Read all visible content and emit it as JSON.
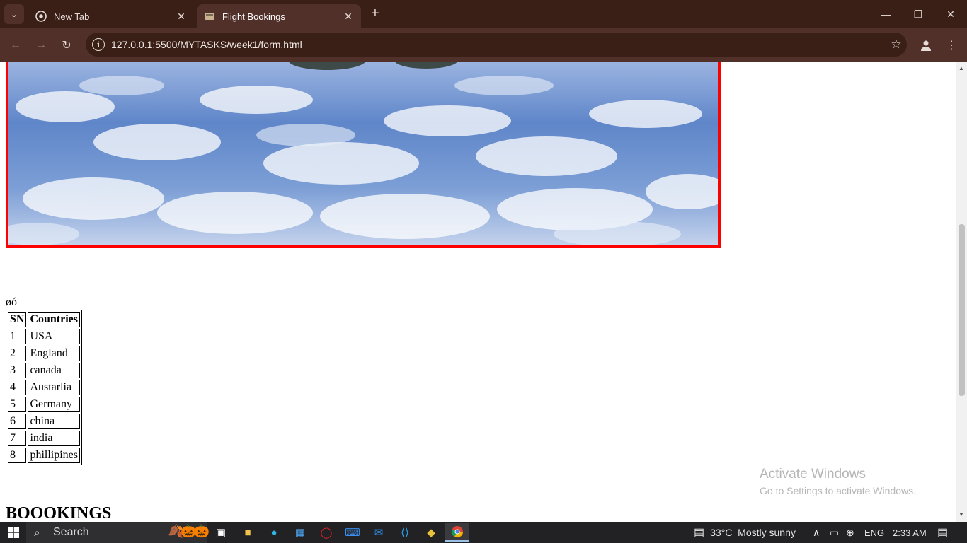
{
  "browser": {
    "tabs": [
      {
        "title": "New Tab",
        "active": false
      },
      {
        "title": "Flight Bookings",
        "active": true
      }
    ],
    "url": "127.0.0.1:5500/MYTASKS/week1/form.html"
  },
  "page": {
    "garbled_text": "øó",
    "table": {
      "headers": [
        "SN",
        "Countries"
      ],
      "rows": [
        [
          "1",
          "USA"
        ],
        [
          "2",
          "England"
        ],
        [
          "3",
          "canada"
        ],
        [
          "4",
          "Austarlia"
        ],
        [
          "5",
          "Germany"
        ],
        [
          "6",
          "china"
        ],
        [
          "7",
          "india"
        ],
        [
          "8",
          "phillipines"
        ]
      ]
    },
    "heading": "BOOOKINGS"
  },
  "watermark": {
    "line1": "Activate Windows",
    "line2": "Go to Settings to activate Windows."
  },
  "taskbar": {
    "search_placeholder": "Search",
    "weather": "33°C  Mostly sunny",
    "language": "ENG",
    "time": "2:33 AM"
  },
  "colors": {
    "chrome_frame": "#3a1f17",
    "chrome_toolbar": "#52302a",
    "hero_border": "#ff0000"
  }
}
